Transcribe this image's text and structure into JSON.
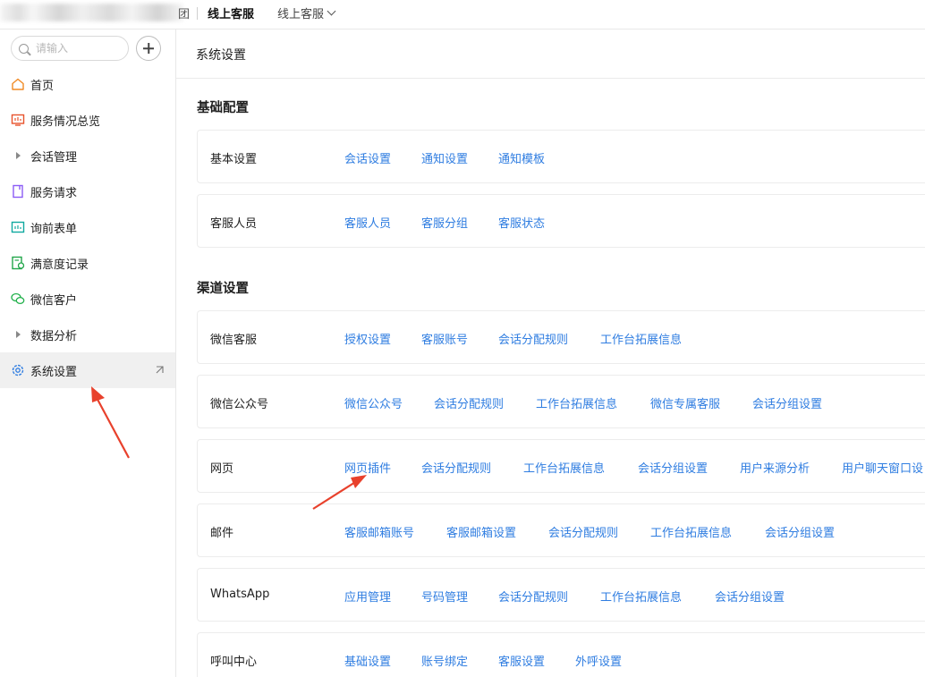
{
  "header": {
    "blur_tail": "团",
    "title": "线上客服",
    "switcher": "线上客服"
  },
  "search": {
    "placeholder": "请输入"
  },
  "sidebar": {
    "items": [
      {
        "label": "首页",
        "icon": "home-icon"
      },
      {
        "label": "服务情况总览",
        "icon": "monitor-icon"
      },
      {
        "label": "会话管理",
        "icon": "caret-right-icon"
      },
      {
        "label": "服务请求",
        "icon": "bookmark-icon"
      },
      {
        "label": "询前表单",
        "icon": "form-icon"
      },
      {
        "label": "满意度记录",
        "icon": "survey-icon"
      },
      {
        "label": "微信客户",
        "icon": "wechat-icon"
      },
      {
        "label": "数据分析",
        "icon": "caret-right-icon"
      },
      {
        "label": "系统设置",
        "icon": "gear-icon",
        "active": true
      }
    ]
  },
  "main": {
    "title": "系统设置",
    "sections": [
      {
        "title": "基础配置",
        "rows": [
          {
            "label": "基本设置",
            "links": [
              "会话设置",
              "通知设置",
              "通知模板"
            ]
          },
          {
            "label": "客服人员",
            "links": [
              "客服人员",
              "客服分组",
              "客服状态"
            ]
          }
        ]
      },
      {
        "title": "渠道设置",
        "rows": [
          {
            "label": "微信客服",
            "links": [
              "授权设置",
              "客服账号",
              "会话分配规则",
              "工作台拓展信息"
            ]
          },
          {
            "label": "微信公众号",
            "links": [
              "微信公众号",
              "会话分配规则",
              "工作台拓展信息",
              "微信专属客服",
              "会话分组设置"
            ]
          },
          {
            "label": "网页",
            "links": [
              "网页插件",
              "会话分配规则",
              "工作台拓展信息",
              "会话分组设置",
              "用户来源分析",
              "用户聊天窗口设"
            ]
          },
          {
            "label": "邮件",
            "links": [
              "客服邮箱账号",
              "客服邮箱设置",
              "会话分配规则",
              "工作台拓展信息",
              "会话分组设置"
            ]
          },
          {
            "label": "WhatsApp",
            "links": [
              "应用管理",
              "号码管理",
              "会话分配规则",
              "工作台拓展信息",
              "会话分组设置"
            ]
          },
          {
            "label": "呼叫中心",
            "links": [
              "基础设置",
              "账号绑定",
              "客服设置",
              "外呼设置"
            ]
          }
        ]
      }
    ]
  },
  "colors": {
    "link": "#2f7de1",
    "annotation_arrow": "#e8412c"
  }
}
